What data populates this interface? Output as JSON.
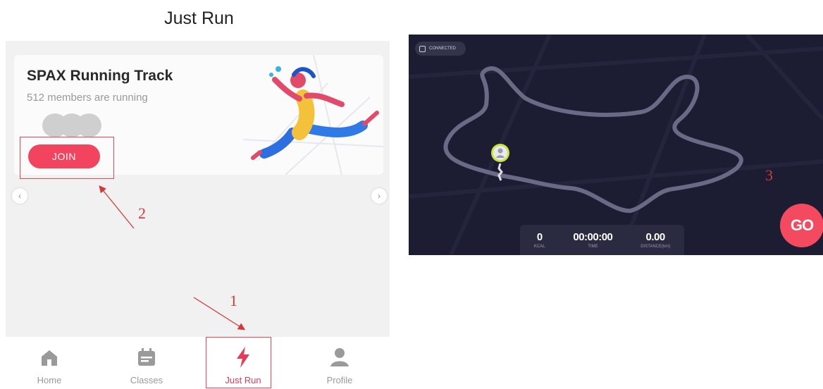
{
  "header": {
    "title": "Just Run"
  },
  "banner": {
    "title": "SPAX Running Track",
    "subtitle": "512 members are running",
    "join_label": "JOIN"
  },
  "carousel": {
    "prev_icon": "chevron-left-icon",
    "next_icon": "chevron-right-icon"
  },
  "tabs": [
    {
      "label": "Home",
      "icon": "home-icon",
      "active": false
    },
    {
      "label": "Classes",
      "icon": "calendar-icon",
      "active": false
    },
    {
      "label": "Just Run",
      "icon": "lightning-icon",
      "active": true
    },
    {
      "label": "Profile",
      "icon": "profile-icon",
      "active": false
    }
  ],
  "annotations": {
    "step1": "1",
    "step2": "2",
    "step3": "3"
  },
  "run": {
    "status_label": "CONNECTED",
    "stats": [
      {
        "value": "0",
        "label": "KCAL"
      },
      {
        "value": "00:00:00",
        "label": "TIME"
      },
      {
        "value": "0.00",
        "label": "DISTANCE(km)"
      }
    ],
    "go_label": "GO"
  },
  "colors": {
    "accent": "#f2445f",
    "annotation": "#e7485c",
    "run_bg": "#1c1c33",
    "track": "#6a6a86",
    "marker": "#c8e63a"
  }
}
